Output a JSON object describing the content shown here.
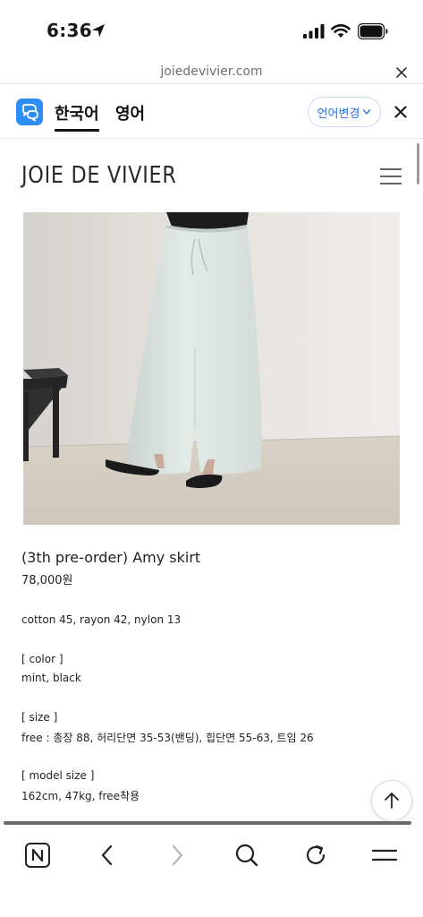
{
  "status_bar": {
    "time": "6:36"
  },
  "url_bar": {
    "domain": "joiedevivier.com"
  },
  "translate_bar": {
    "tab_korean": "한국어",
    "tab_english": "영어",
    "change_language": "언어변경",
    "accent_color": "#2f8ef3"
  },
  "site": {
    "logo": "JOIE DE VIVIER"
  },
  "product": {
    "title": "(3th pre-order) Amy skirt",
    "price": "78,000원",
    "details": [
      "cotton 45, rayon 42, nylon 13",
      "[ color ]",
      "mint, black",
      "[ size ]",
      "free : 총장 88, 허리단면 35-53(밴딩), 힙단면 55-63, 트임 26",
      "[ model size ]",
      "162cm, 47kg, free착용"
    ]
  },
  "toolbar": {
    "icons": [
      "naver-home-icon",
      "back-icon",
      "forward-icon",
      "search-icon",
      "refresh-icon",
      "menu-icon"
    ]
  }
}
